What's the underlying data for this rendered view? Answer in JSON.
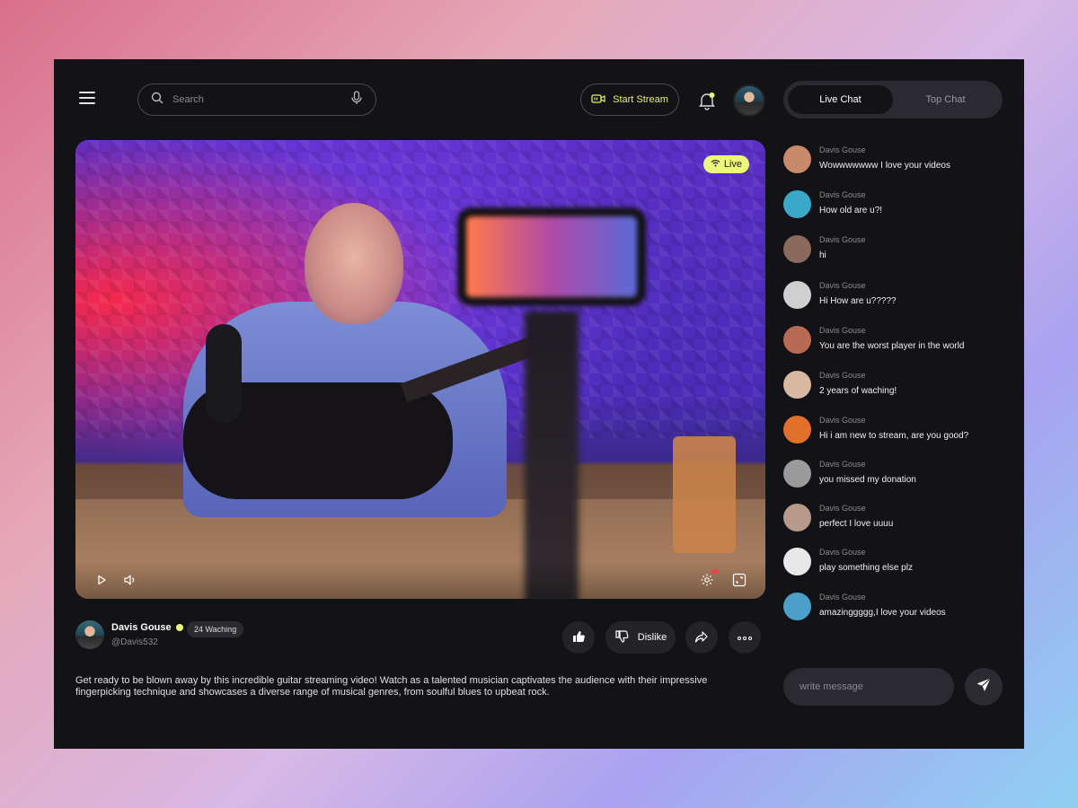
{
  "header": {
    "search_placeholder": "Search",
    "start_stream_label": "Start Stream"
  },
  "video": {
    "live_label": "Live"
  },
  "channel": {
    "name": "Davis Gouse",
    "handle": "@Davis532",
    "watching": "24 Waching",
    "dislike_label": "Dislike",
    "description": "Get ready to be blown away by this incredible guitar streaming video! Watch as a talented musician captivates the audience with their impressive fingerpicking technique and showcases a diverse range of musical genres, from soulful blues to upbeat rock."
  },
  "chat": {
    "tabs": [
      {
        "label": "Live Chat",
        "active": true
      },
      {
        "label": "Top Chat",
        "active": false
      }
    ],
    "messages": [
      {
        "name": "Davis Gouse",
        "text": "Wowwwwwww I love your videos",
        "avatar_color": "#c98a6a"
      },
      {
        "name": "Davis Gouse",
        "text": "How old are u?!",
        "avatar_color": "#3aa8c8"
      },
      {
        "name": "Davis Gouse",
        "text": "hi",
        "avatar_color": "#8a6a5a"
      },
      {
        "name": "Davis Gouse",
        "text": "Hi How are u?????",
        "avatar_color": "#cfcfcf"
      },
      {
        "name": "Davis Gouse",
        "text": "You are the worst player in the world",
        "avatar_color": "#b86a52"
      },
      {
        "name": "Davis Gouse",
        "text": "2 years of waching!",
        "avatar_color": "#d8b8a0"
      },
      {
        "name": "Davis Gouse",
        "text": "Hi i am new  to stream, are you good?",
        "avatar_color": "#e0702a"
      },
      {
        "name": "Davis Gouse",
        "text": "you missed my donation",
        "avatar_color": "#9a9a9a"
      },
      {
        "name": "Davis Gouse",
        "text": "perfect I love uuuu",
        "avatar_color": "#b89a8a"
      },
      {
        "name": "Davis Gouse",
        "text": "play something else plz",
        "avatar_color": "#e8e8e8"
      },
      {
        "name": "Davis Gouse",
        "text": "amazinggggg,I love your videos",
        "avatar_color": "#4aa0c8"
      }
    ],
    "input_placeholder": "write message"
  },
  "colors": {
    "accent": "#e9f77a",
    "panel": "#131217",
    "surface": "#2a2a30"
  }
}
